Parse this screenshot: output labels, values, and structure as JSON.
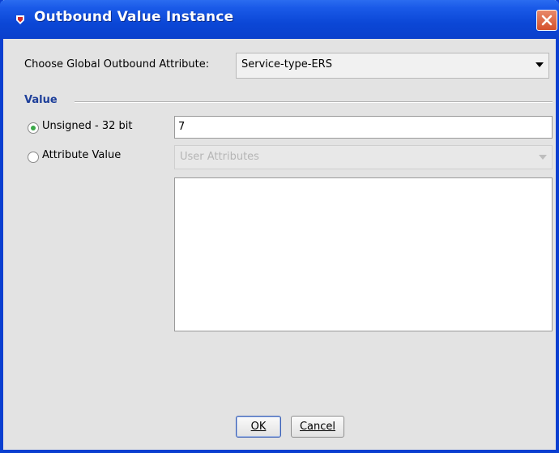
{
  "window": {
    "title": "Outbound Value Instance"
  },
  "global_attr": {
    "label": "Choose Global Outbound Attribute:",
    "selected": "Service-type-ERS"
  },
  "value_group": {
    "title": "Value",
    "unsigned": {
      "label": "Unsigned - 32 bit",
      "selected": true,
      "value": "7"
    },
    "attribute": {
      "label": "Attribute Value",
      "selected": false,
      "combo": "User Attributes"
    }
  },
  "buttons": {
    "ok": "OK",
    "cancel": "Cancel"
  },
  "colors": {
    "titlebar": "#0b47d6",
    "window_bg": "#e3e3e3",
    "section_title": "#1e3f9a",
    "radio_dot": "#3aa848"
  }
}
